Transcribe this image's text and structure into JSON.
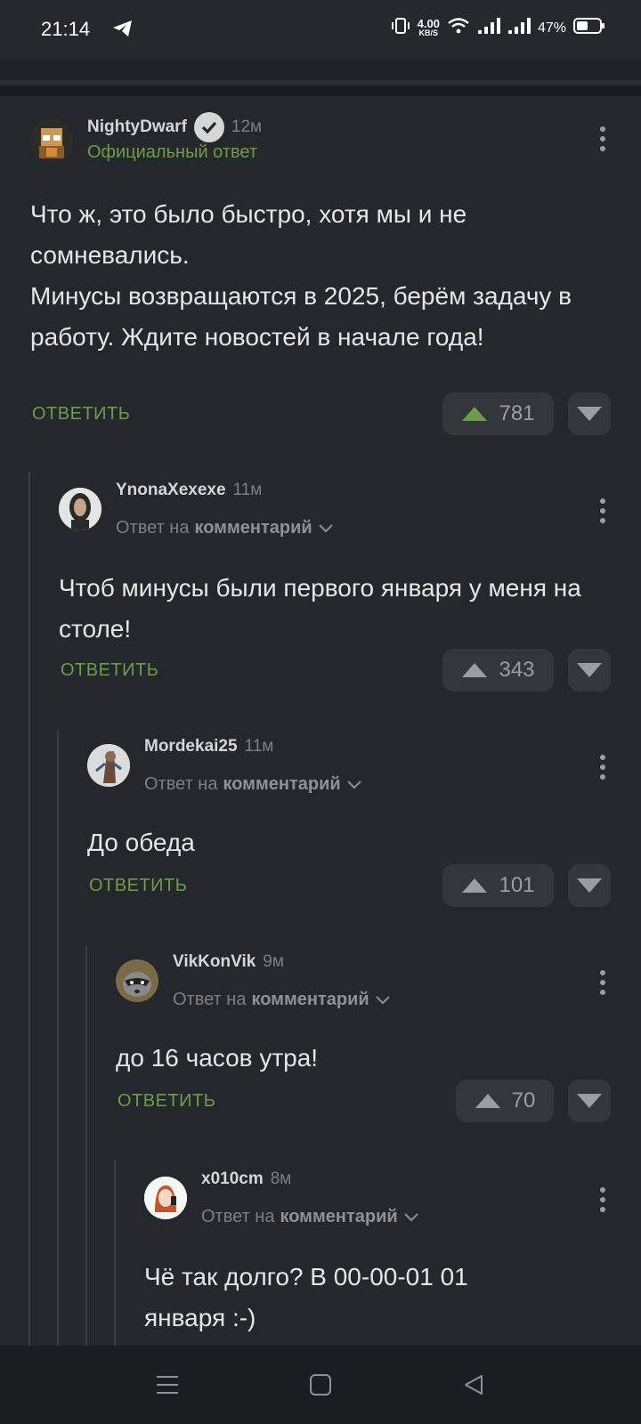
{
  "status_bar": {
    "time": "21:14",
    "net_speed_value": "4.00",
    "net_speed_unit": "KB/S",
    "battery": "47%"
  },
  "labels": {
    "reply": "ОТВЕТИТЬ",
    "reply_to_prefix": "Ответ на",
    "reply_to_target": "комментарий",
    "official": "Официальный ответ"
  },
  "comments": [
    {
      "author": "NightyDwarf",
      "time": "12м",
      "text": "Что ж, это было быстро, хотя мы и не сомневались.\nМинусы возвращаются в 2025, берём задачу в работу. Ждите новостей в начале года!",
      "votes": "781"
    },
    {
      "author": "YnonaXexexe",
      "time": "11м",
      "text": "Чтоб минусы были первого января у меня на столе!",
      "votes": "343"
    },
    {
      "author": "Mordekai25",
      "time": "11м",
      "text": "До обеда",
      "votes": "101"
    },
    {
      "author": "VikKonVik",
      "time": "9м",
      "text": "до 16 часов утра!",
      "votes": "70"
    },
    {
      "author": "x010cm",
      "time": "8м",
      "text": "Чё так долго? В 00-00-01 01 января :-)"
    }
  ],
  "colors": {
    "accent_green": "#6f9c48",
    "background": "#24272b",
    "vote_button": "#33363b"
  }
}
